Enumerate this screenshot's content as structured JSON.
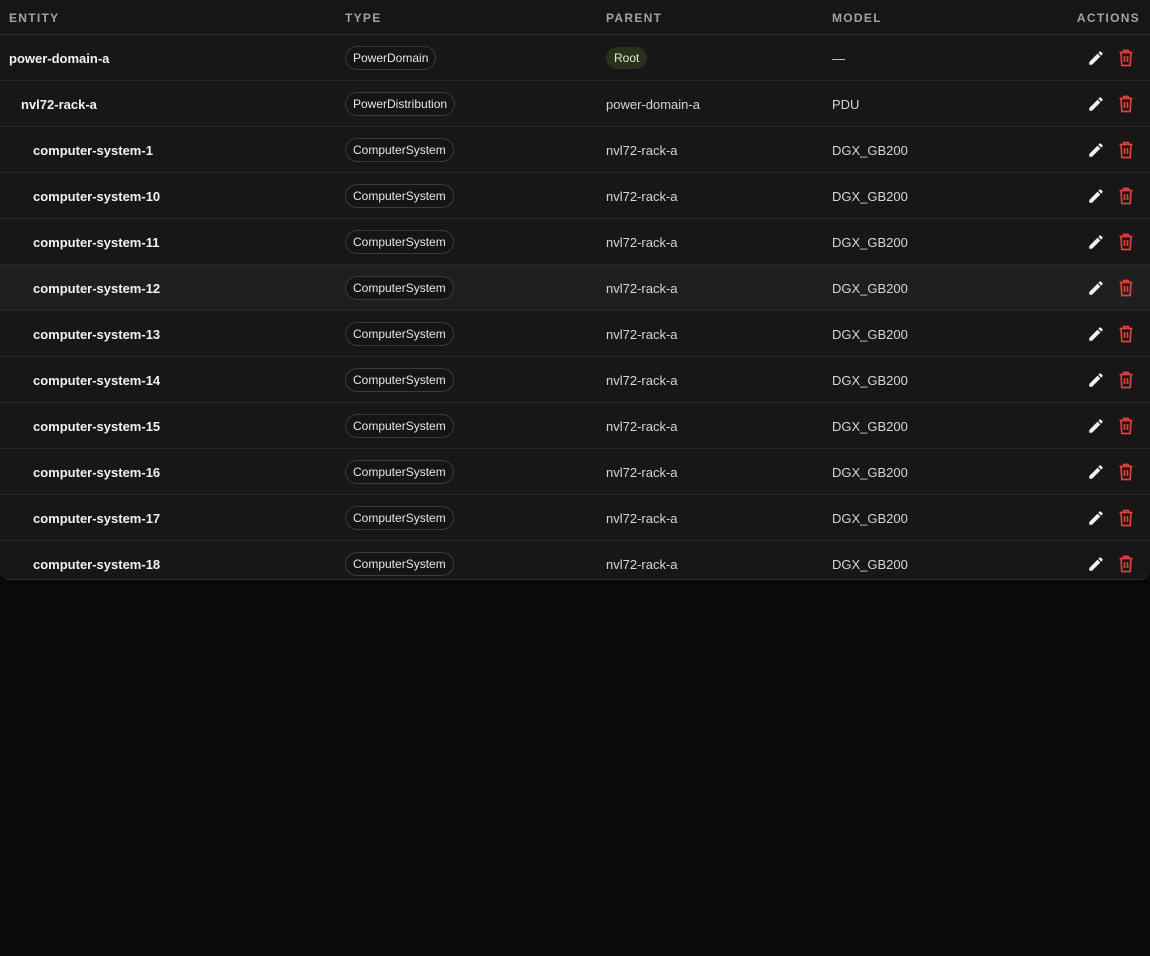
{
  "columns": {
    "entity": "ENTITY",
    "type": "TYPE",
    "parent": "PARENT",
    "model": "MODEL",
    "actions": "ACTIONS"
  },
  "colors": {
    "edit_icon": "#f0f0f0",
    "delete_icon": "#e0413b",
    "root_badge_bg": "#28321b"
  },
  "rows": [
    {
      "entity": "power-domain-a",
      "depth": 0,
      "type": "PowerDomain",
      "parent": "Root",
      "parent_is_root": true,
      "model": "—"
    },
    {
      "entity": "nvl72-rack-a",
      "depth": 1,
      "type": "PowerDistribution",
      "parent": "power-domain-a",
      "parent_is_root": false,
      "model": "PDU"
    },
    {
      "entity": "computer-system-1",
      "depth": 2,
      "type": "ComputerSystem",
      "parent": "nvl72-rack-a",
      "parent_is_root": false,
      "model": "DGX_GB200"
    },
    {
      "entity": "computer-system-10",
      "depth": 2,
      "type": "ComputerSystem",
      "parent": "nvl72-rack-a",
      "parent_is_root": false,
      "model": "DGX_GB200"
    },
    {
      "entity": "computer-system-11",
      "depth": 2,
      "type": "ComputerSystem",
      "parent": "nvl72-rack-a",
      "parent_is_root": false,
      "model": "DGX_GB200"
    },
    {
      "entity": "computer-system-12",
      "depth": 2,
      "type": "ComputerSystem",
      "parent": "nvl72-rack-a",
      "parent_is_root": false,
      "model": "DGX_GB200",
      "hovered": true
    },
    {
      "entity": "computer-system-13",
      "depth": 2,
      "type": "ComputerSystem",
      "parent": "nvl72-rack-a",
      "parent_is_root": false,
      "model": "DGX_GB200"
    },
    {
      "entity": "computer-system-14",
      "depth": 2,
      "type": "ComputerSystem",
      "parent": "nvl72-rack-a",
      "parent_is_root": false,
      "model": "DGX_GB200"
    },
    {
      "entity": "computer-system-15",
      "depth": 2,
      "type": "ComputerSystem",
      "parent": "nvl72-rack-a",
      "parent_is_root": false,
      "model": "DGX_GB200"
    },
    {
      "entity": "computer-system-16",
      "depth": 2,
      "type": "ComputerSystem",
      "parent": "nvl72-rack-a",
      "parent_is_root": false,
      "model": "DGX_GB200"
    },
    {
      "entity": "computer-system-17",
      "depth": 2,
      "type": "ComputerSystem",
      "parent": "nvl72-rack-a",
      "parent_is_root": false,
      "model": "DGX_GB200"
    },
    {
      "entity": "computer-system-18",
      "depth": 2,
      "type": "ComputerSystem",
      "parent": "nvl72-rack-a",
      "parent_is_root": false,
      "model": "DGX_GB200"
    }
  ],
  "row_actions": [
    {
      "name": "edit",
      "icon": "pencil-icon"
    },
    {
      "name": "delete",
      "icon": "trash-icon"
    }
  ]
}
